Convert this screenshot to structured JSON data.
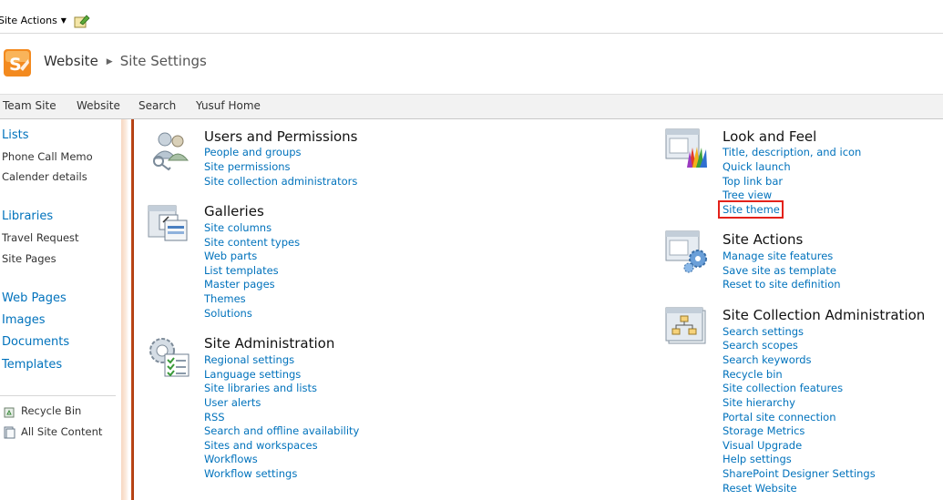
{
  "ribbon": {
    "site_actions": "Site Actions"
  },
  "breadcrumb": {
    "site": "Website",
    "page": "Site Settings"
  },
  "topnav": [
    "Team Site",
    "Website",
    "Search",
    "Yusuf Home"
  ],
  "leftnav": {
    "lists_header": "Lists",
    "lists": [
      "Phone Call Memo",
      "Calender details"
    ],
    "libraries_header": "Libraries",
    "libraries": [
      "Travel Request",
      "Site Pages"
    ],
    "web_pages": "Web Pages",
    "images": "Images",
    "documents": "Documents",
    "templates": "Templates",
    "recycle_bin": "Recycle Bin",
    "all_site_content": "All Site Content"
  },
  "sections": {
    "users": {
      "title": "Users and Permissions",
      "links": [
        "People and groups",
        "Site permissions",
        "Site collection administrators"
      ]
    },
    "galleries": {
      "title": "Galleries",
      "links": [
        "Site columns",
        "Site content types",
        "Web parts",
        "List templates",
        "Master pages",
        "Themes",
        "Solutions"
      ]
    },
    "site_admin": {
      "title": "Site Administration",
      "links": [
        "Regional settings",
        "Language settings",
        "Site libraries and lists",
        "User alerts",
        "RSS",
        "Search and offline availability",
        "Sites and workspaces",
        "Workflows",
        "Workflow settings"
      ]
    },
    "look_feel": {
      "title": "Look and Feel",
      "links": [
        "Title, description, and icon",
        "Quick launch",
        "Top link bar",
        "Tree view",
        "Site theme"
      ]
    },
    "site_actions": {
      "title": "Site Actions",
      "links": [
        "Manage site features",
        "Save site as template",
        "Reset to site definition"
      ]
    },
    "collection_admin": {
      "title": "Site Collection Administration",
      "links": [
        "Search settings",
        "Search scopes",
        "Search keywords",
        "Recycle bin",
        "Site collection features",
        "Site hierarchy",
        "Portal site connection",
        "Storage Metrics",
        "Visual Upgrade",
        "Help settings",
        "SharePoint Designer Settings",
        "Reset Website"
      ]
    }
  },
  "colors": {
    "link": "#0072bc",
    "highlight": "#e3211a",
    "accent": "#c44a18"
  }
}
